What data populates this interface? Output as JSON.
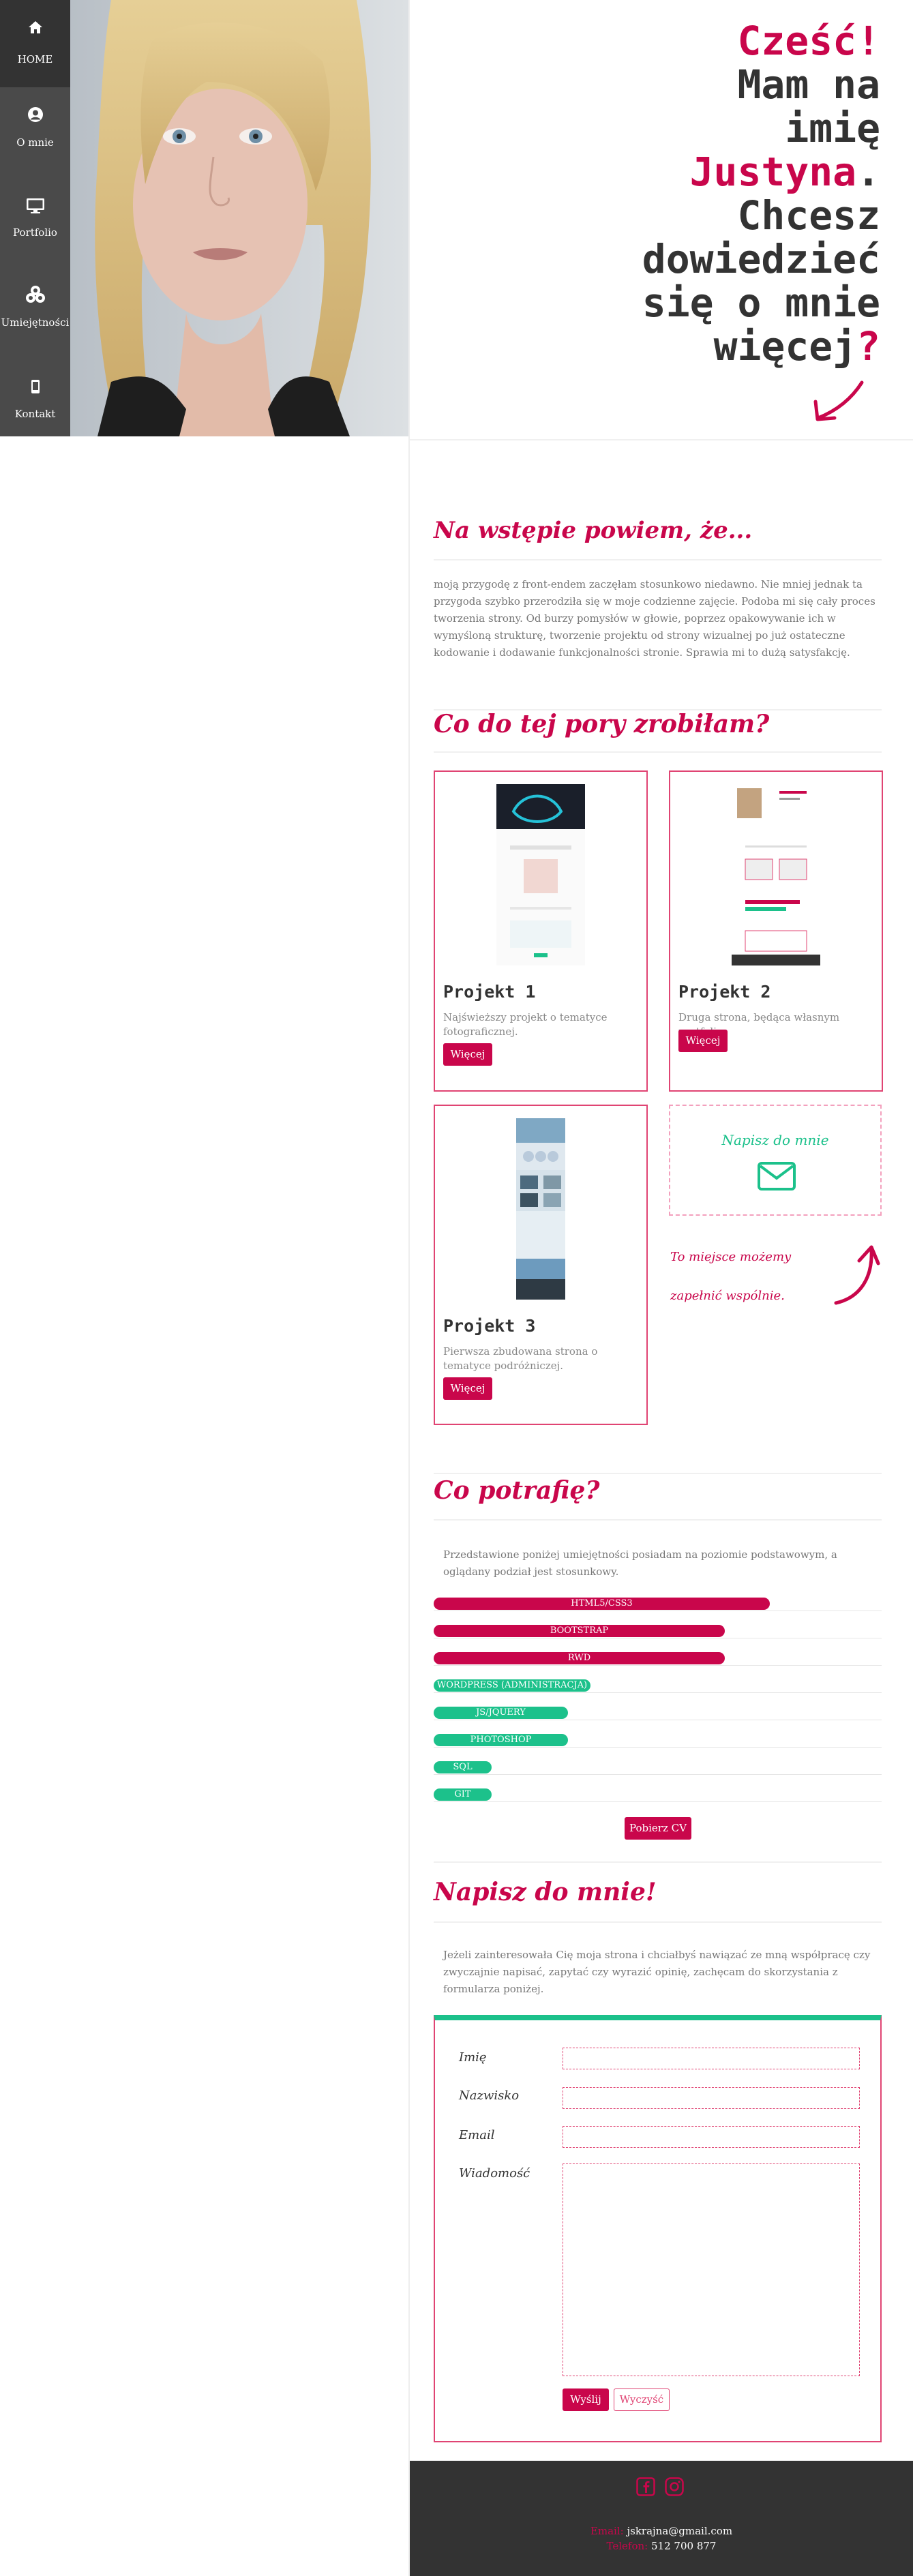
{
  "nav": [
    {
      "label": "HOME",
      "icon": "home-icon",
      "active": true
    },
    {
      "label": "O mnie",
      "icon": "user-circle-icon"
    },
    {
      "label": "Portfolio",
      "icon": "monitor-icon"
    },
    {
      "label": "Umiejętności",
      "icon": "cubes-icon"
    },
    {
      "label": "Kontakt",
      "icon": "phone-icon"
    }
  ],
  "hero": {
    "l1a": "Cześć",
    "l1b": "!",
    "l2": "Mam na",
    "l3": "imię",
    "l4a": "Justyna",
    "l4b": ".",
    "l5": "Chcesz",
    "l6": "dowiedzieć",
    "l7": "się o mnie",
    "l8a": "więcej",
    "l8b": "?"
  },
  "about": {
    "heading": "Na wstępie powiem, że...",
    "text": "moją przygodę z front-endem zaczęłam stosunkowo niedawno. Nie mniej jednak ta przygoda szybko przerodziła się w moje codzienne zajęcie. Podoba mi się cały proces tworzenia strony. Od burzy pomysłów w głowie, poprzez opakowywanie ich w wymyśloną strukturę, tworzenie projektu od strony wizualnej po już ostateczne kodowanie i dodawanie funkcjonalności stronie. Sprawia mi to dużą satysfakcję."
  },
  "portfolio": {
    "heading": "Co do tej pory zrobiłam?",
    "projects": [
      {
        "title": "Projekt 1",
        "desc": "Najświeższy projekt o tematyce fotograficznej.",
        "button": "Więcej"
      },
      {
        "title": "Projekt 2",
        "desc": "Druga strona, będąca własnym portfolio.",
        "button": "Więcej"
      },
      {
        "title": "Projekt 3",
        "desc": "Pierwsza zbudowana strona o tematyce podróżniczej.",
        "button": "Więcej"
      }
    ],
    "contact_card": {
      "label": "Napisz do mnie"
    },
    "note_line1": "To miejsce możemy",
    "note_line2": "zapełnić wspólnie."
  },
  "skills": {
    "heading": "Co potrafię?",
    "text": "Przedstawione poniżej umiejętności posiadam na poziomie podstawowym, a oglądany podział jest stosunkowy.",
    "items": [
      {
        "label": "HTML5/CSS3",
        "level": 0.75,
        "color": "#c9064b"
      },
      {
        "label": "BOOTSTRAP",
        "level": 0.65,
        "color": "#c9064b"
      },
      {
        "label": "RWD",
        "level": 0.65,
        "color": "#c9064b"
      },
      {
        "label": "WORDPRESS (ADMINISTRACJA)",
        "level": 0.35,
        "color": "#1cc18b"
      },
      {
        "label": "JS/JQUERY",
        "level": 0.3,
        "color": "#1cc18b"
      },
      {
        "label": "PHOTOSHOP",
        "level": 0.3,
        "color": "#1cc18b"
      },
      {
        "label": "SQL",
        "level": 0.13,
        "color": "#1cc18b"
      },
      {
        "label": "GIT",
        "level": 0.13,
        "color": "#1cc18b"
      }
    ],
    "cv_button": "Pobierz CV"
  },
  "contact": {
    "heading": "Napisz do mnie!",
    "text": "Jeżeli zainteresowała Cię moja strona i chciałbyś nawiązać ze mną współpracę czy zwyczajnie napisać, zapytać czy wyrazić opinię, zachęcam do skorzystania z formularza poniżej.",
    "fields": [
      "Imię",
      "Nazwisko",
      "Email",
      "Wiadomość"
    ],
    "send": "Wyślij",
    "clear": "Wyczyść"
  },
  "footer": {
    "email_label": "Email:",
    "email": "jskrajna@gmail.com",
    "phone_label": "Telefon:",
    "phone": "512 700 877",
    "icons": [
      "facebook-icon",
      "instagram-icon"
    ]
  },
  "colors": {
    "accent": "#c9064b",
    "green": "#1cc18b",
    "sidebar": "#4a4a4a",
    "footer": "#333333"
  }
}
